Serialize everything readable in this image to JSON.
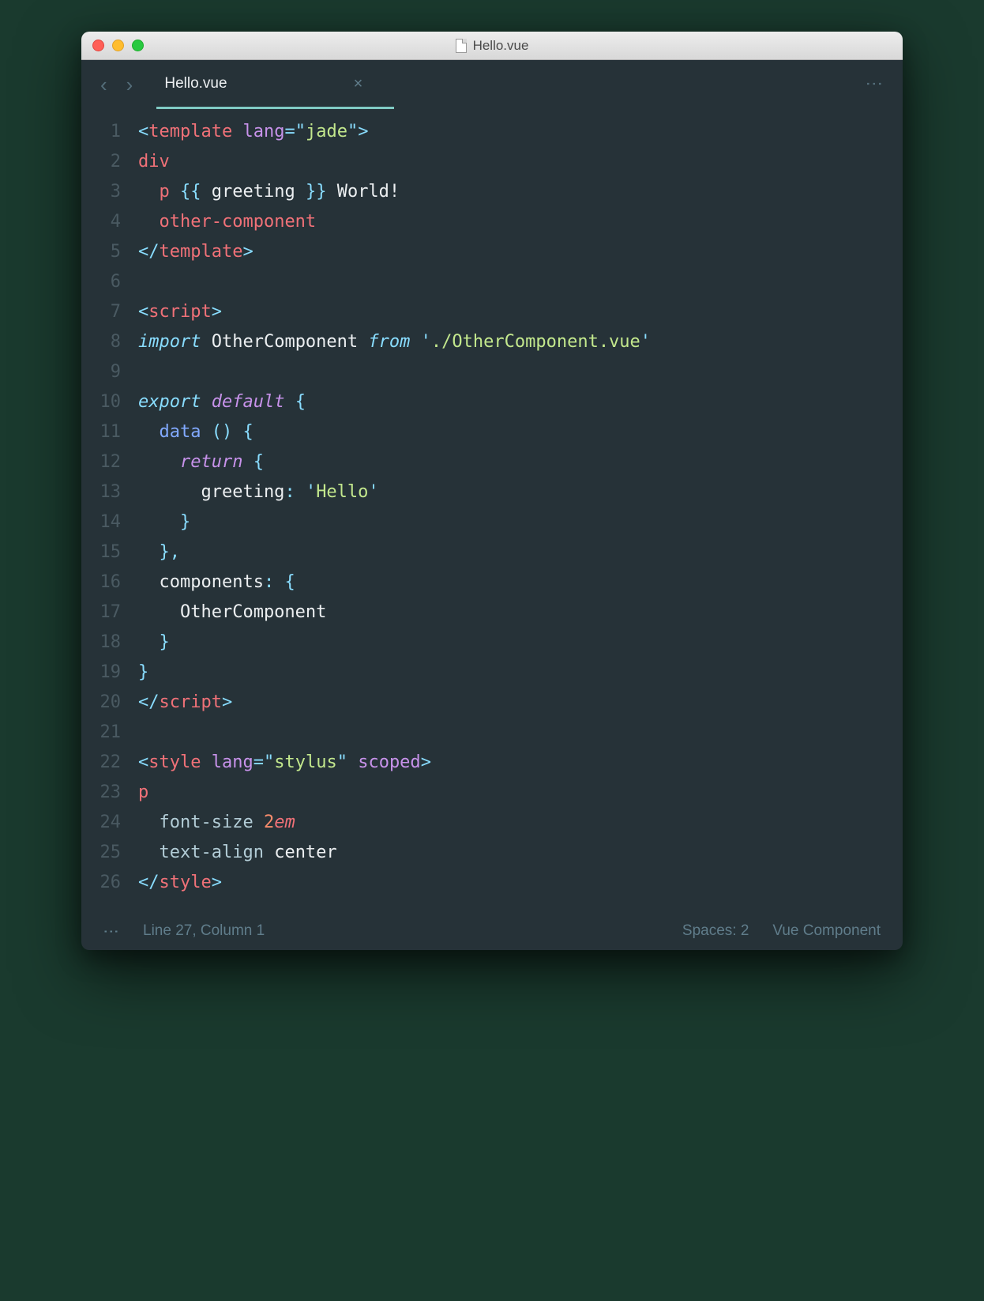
{
  "window": {
    "title": "Hello.vue"
  },
  "tab": {
    "name": "Hello.vue"
  },
  "code": {
    "lines": [
      {
        "n": 1,
        "tokens": [
          [
            "punc",
            "<"
          ],
          [
            "tag",
            "template"
          ],
          [
            "ident",
            " "
          ],
          [
            "attr",
            "lang"
          ],
          [
            "punc",
            "="
          ],
          [
            "punc",
            "\""
          ],
          [
            "str",
            "jade"
          ],
          [
            "punc",
            "\""
          ],
          [
            "punc",
            ">"
          ]
        ]
      },
      {
        "n": 2,
        "tokens": [
          [
            "tag",
            "div"
          ]
        ]
      },
      {
        "n": 3,
        "tokens": [
          [
            "ident",
            "  "
          ],
          [
            "tag",
            "p"
          ],
          [
            "ident",
            " "
          ],
          [
            "punc",
            "{{"
          ],
          [
            "ident",
            " greeting "
          ],
          [
            "punc",
            "}}"
          ],
          [
            "ident",
            " World!"
          ]
        ]
      },
      {
        "n": 4,
        "tokens": [
          [
            "ident",
            "  "
          ],
          [
            "tag",
            "other-component"
          ]
        ]
      },
      {
        "n": 5,
        "tokens": [
          [
            "punc",
            "</"
          ],
          [
            "tag",
            "template"
          ],
          [
            "punc",
            ">"
          ]
        ]
      },
      {
        "n": 6,
        "tokens": []
      },
      {
        "n": 7,
        "tokens": [
          [
            "punc",
            "<"
          ],
          [
            "tag",
            "script"
          ],
          [
            "punc",
            ">"
          ]
        ]
      },
      {
        "n": 8,
        "tokens": [
          [
            "kw",
            "import"
          ],
          [
            "ident",
            " OtherComponent "
          ],
          [
            "kw",
            "from"
          ],
          [
            "ident",
            " "
          ],
          [
            "punc",
            "'"
          ],
          [
            "str",
            "./OtherComponent.vue"
          ],
          [
            "punc",
            "'"
          ]
        ]
      },
      {
        "n": 9,
        "tokens": []
      },
      {
        "n": 10,
        "tokens": [
          [
            "kw",
            "export"
          ],
          [
            "ident",
            " "
          ],
          [
            "kw2",
            "default"
          ],
          [
            "ident",
            " "
          ],
          [
            "punc",
            "{"
          ]
        ]
      },
      {
        "n": 11,
        "tokens": [
          [
            "ident",
            "  "
          ],
          [
            "fn",
            "data"
          ],
          [
            "ident",
            " "
          ],
          [
            "punc",
            "()"
          ],
          [
            "ident",
            " "
          ],
          [
            "punc",
            "{"
          ]
        ]
      },
      {
        "n": 12,
        "tokens": [
          [
            "ident",
            "    "
          ],
          [
            "kw2",
            "return"
          ],
          [
            "ident",
            " "
          ],
          [
            "punc",
            "{"
          ]
        ]
      },
      {
        "n": 13,
        "tokens": [
          [
            "ident",
            "      greeting"
          ],
          [
            "punc",
            ":"
          ],
          [
            "ident",
            " "
          ],
          [
            "punc",
            "'"
          ],
          [
            "str",
            "Hello"
          ],
          [
            "punc",
            "'"
          ]
        ]
      },
      {
        "n": 14,
        "tokens": [
          [
            "ident",
            "    "
          ],
          [
            "punc",
            "}"
          ]
        ]
      },
      {
        "n": 15,
        "tokens": [
          [
            "ident",
            "  "
          ],
          [
            "punc",
            "},"
          ]
        ]
      },
      {
        "n": 16,
        "tokens": [
          [
            "ident",
            "  components"
          ],
          [
            "punc",
            ":"
          ],
          [
            "ident",
            " "
          ],
          [
            "punc",
            "{"
          ]
        ]
      },
      {
        "n": 17,
        "tokens": [
          [
            "ident",
            "    OtherComponent"
          ]
        ]
      },
      {
        "n": 18,
        "tokens": [
          [
            "ident",
            "  "
          ],
          [
            "punc",
            "}"
          ]
        ]
      },
      {
        "n": 19,
        "tokens": [
          [
            "punc",
            "}"
          ]
        ]
      },
      {
        "n": 20,
        "tokens": [
          [
            "punc",
            "</"
          ],
          [
            "tag",
            "script"
          ],
          [
            "punc",
            ">"
          ]
        ]
      },
      {
        "n": 21,
        "tokens": []
      },
      {
        "n": 22,
        "tokens": [
          [
            "punc",
            "<"
          ],
          [
            "tag",
            "style"
          ],
          [
            "ident",
            " "
          ],
          [
            "attr",
            "lang"
          ],
          [
            "punc",
            "="
          ],
          [
            "punc",
            "\""
          ],
          [
            "str",
            "stylus"
          ],
          [
            "punc",
            "\""
          ],
          [
            "ident",
            " "
          ],
          [
            "attr",
            "scoped"
          ],
          [
            "punc",
            ">"
          ]
        ]
      },
      {
        "n": 23,
        "tokens": [
          [
            "tag",
            "p"
          ]
        ]
      },
      {
        "n": 24,
        "tokens": [
          [
            "ident",
            "  "
          ],
          [
            "prop",
            "font-size"
          ],
          [
            "ident",
            " "
          ],
          [
            "num",
            "2"
          ],
          [
            "unit",
            "em"
          ]
        ]
      },
      {
        "n": 25,
        "tokens": [
          [
            "ident",
            "  "
          ],
          [
            "prop",
            "text-align"
          ],
          [
            "ident",
            " center"
          ]
        ]
      },
      {
        "n": 26,
        "tokens": [
          [
            "punc",
            "</"
          ],
          [
            "tag",
            "style"
          ],
          [
            "punc",
            ">"
          ]
        ]
      }
    ]
  },
  "status": {
    "cursor": "Line 27, Column 1",
    "spaces": "Spaces: 2",
    "syntax": "Vue Component"
  }
}
